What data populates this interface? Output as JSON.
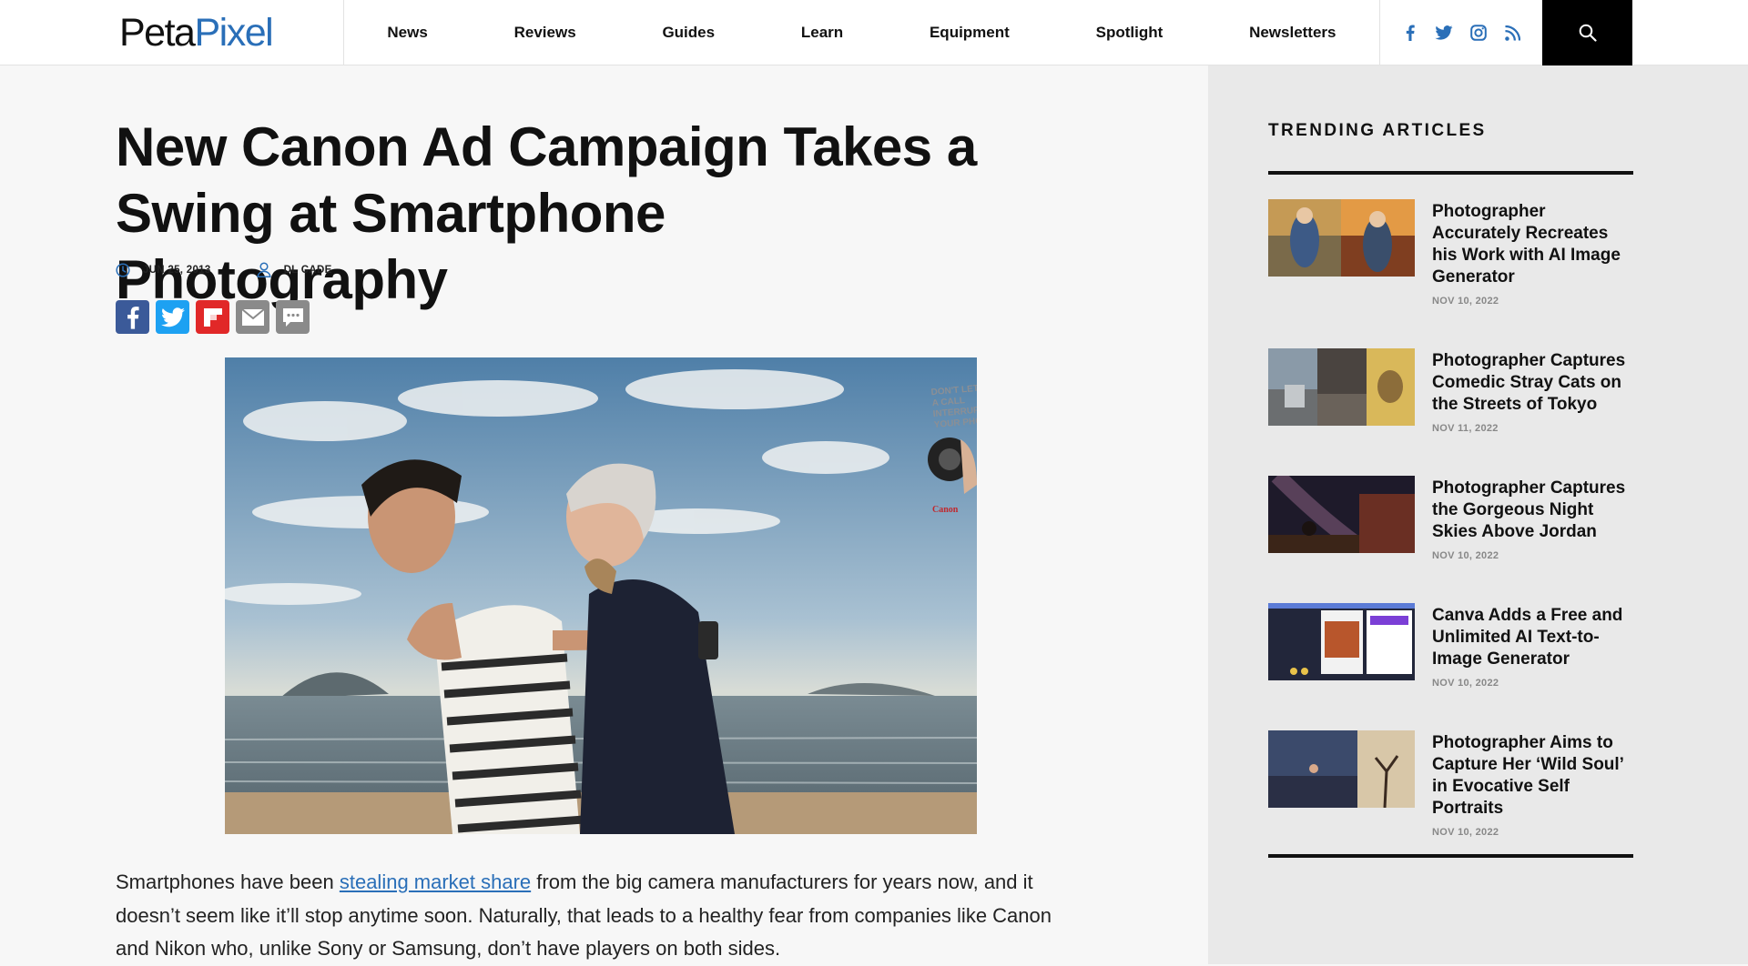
{
  "brand": {
    "name_part1": "Peta",
    "name_part2": "Pixel",
    "accent": "#2a6fb8"
  },
  "nav": {
    "items": [
      "News",
      "Reviews",
      "Guides",
      "Learn",
      "Equipment",
      "Spotlight",
      "Newsletters"
    ]
  },
  "social_icons": [
    "facebook-icon",
    "twitter-icon",
    "instagram-icon",
    "rss-icon"
  ],
  "search": {
    "icon": "search-icon"
  },
  "article": {
    "title": "New Canon Ad Campaign Takes a Swing at Smartphone Photography",
    "date": "JUN 25, 2013",
    "author": "DL CADE",
    "share_buttons": [
      "facebook",
      "twitter",
      "flipboard",
      "email",
      "comment"
    ],
    "hero_ad_text": "DON'T LET A CALL INTERRUPT YOUR PHOTO",
    "hero_brand": "Canon",
    "body": {
      "before_link": "Smartphones have been ",
      "link_text": "stealing market share",
      "after_link": " from the big camera manufacturers for years now, and it doesn’t seem like it’ll stop anytime soon. Naturally, that leads to a healthy fear from companies like Canon and Nikon who, unlike Sony or Samsung, don’t have players on both sides."
    }
  },
  "sidebar": {
    "heading": "TRENDING ARTICLES",
    "items": [
      {
        "title": "Photographer Accurately Recreates his Work with AI Image Generator",
        "date": "NOV 10, 2022"
      },
      {
        "title": "Photographer Captures Comedic Stray Cats on the Streets of Tokyo",
        "date": "NOV 11, 2022"
      },
      {
        "title": "Photographer Captures the Gorgeous Night Skies Above Jordan",
        "date": "NOV 10, 2022"
      },
      {
        "title": "Canva Adds a Free and Unlimited AI Text-to-Image Generator",
        "date": "NOV 10, 2022"
      },
      {
        "title": "Photographer Aims to Capture Her ‘Wild Soul’ in Evocative Self Portraits",
        "date": "NOV 10, 2022"
      }
    ]
  }
}
